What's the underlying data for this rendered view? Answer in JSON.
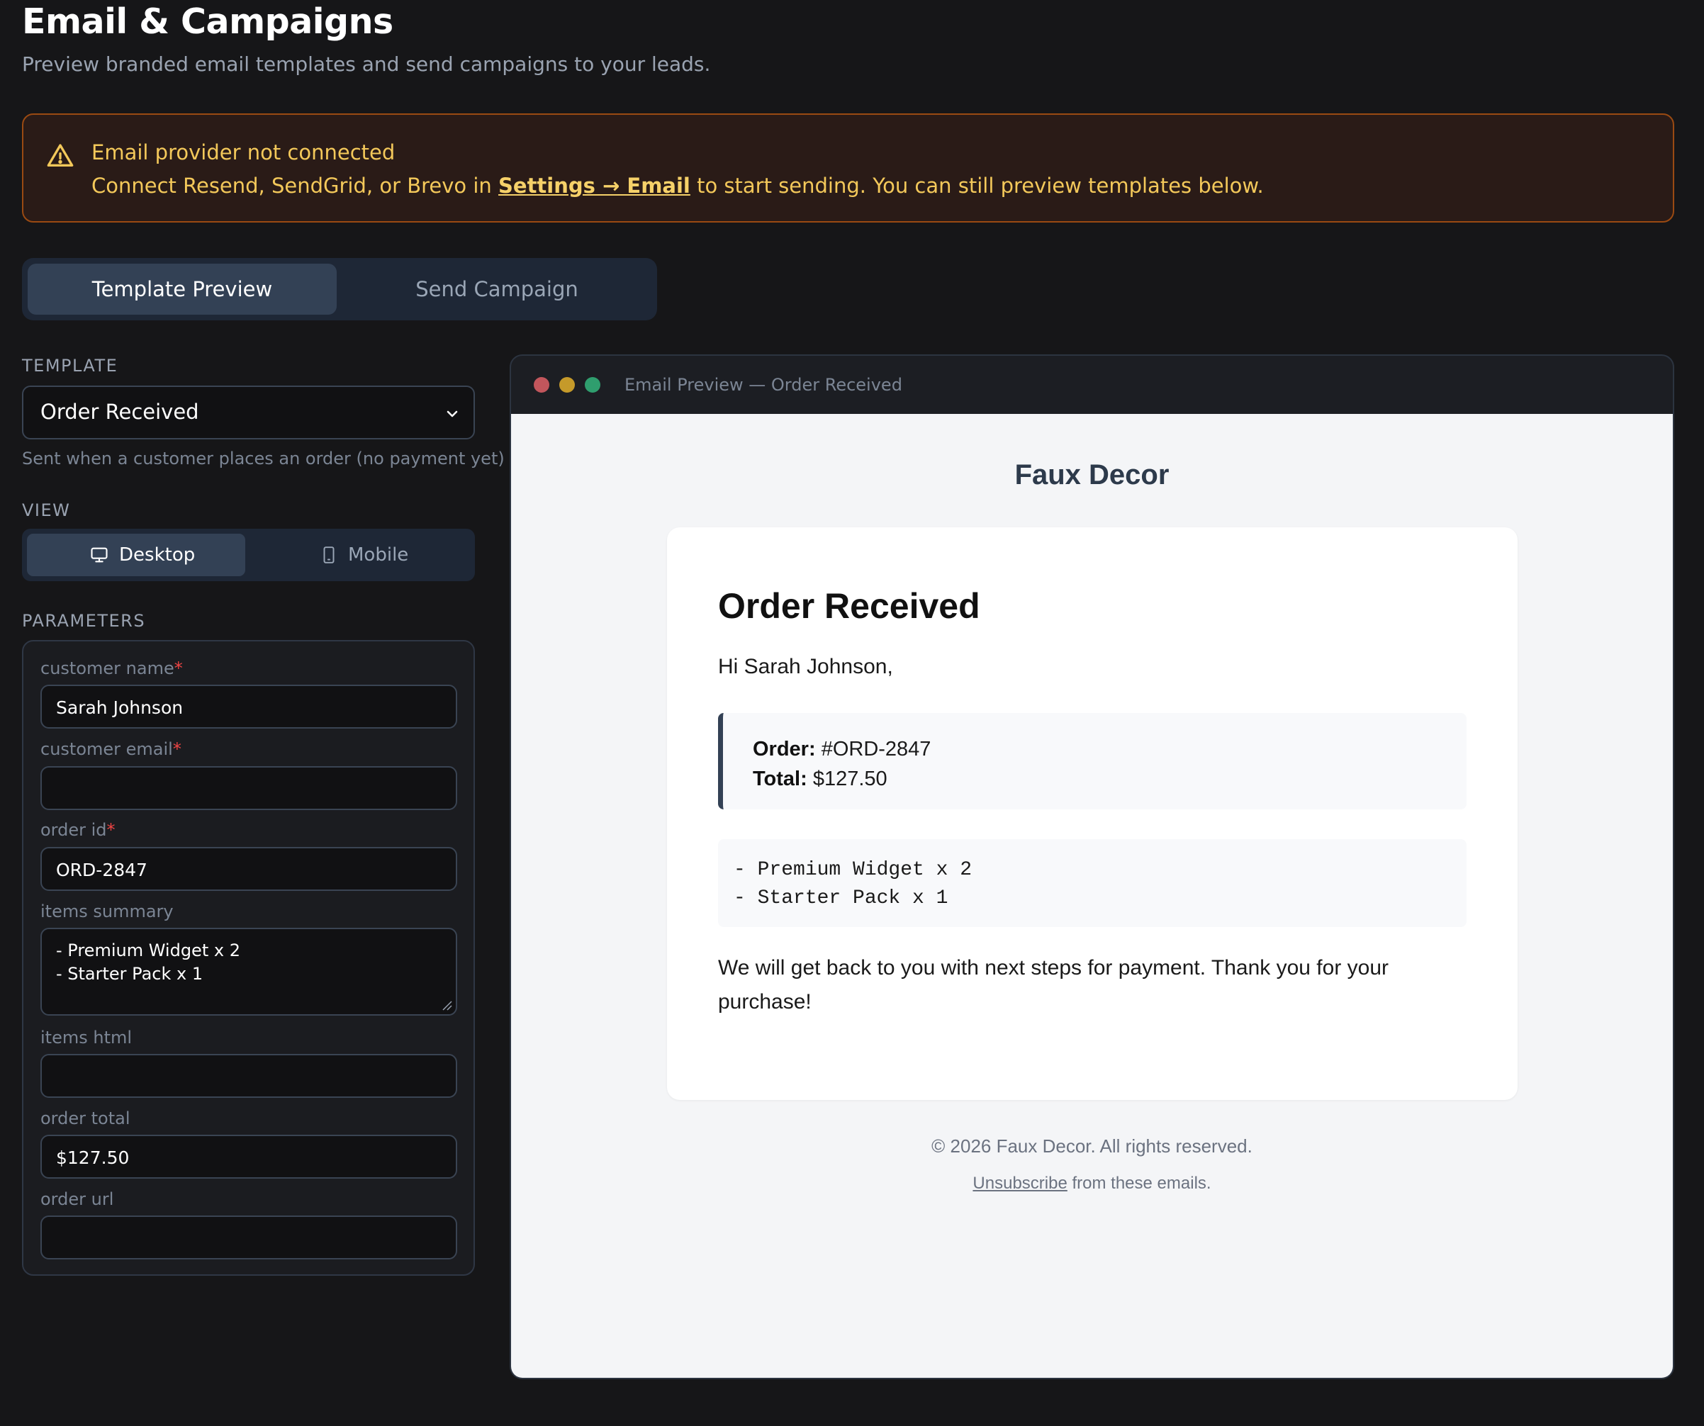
{
  "header": {
    "title": "Email & Campaigns",
    "subtitle": "Preview branded email templates and send campaigns to your leads."
  },
  "alert": {
    "icon": "warning-triangle-icon",
    "title": "Email provider not connected",
    "body_before": "Connect Resend, SendGrid, or Brevo in ",
    "link": "Settings → Email",
    "body_after": " to start sending. You can still preview templates below."
  },
  "tabs": [
    {
      "label": "Template Preview",
      "active": true
    },
    {
      "label": "Send Campaign",
      "active": false
    }
  ],
  "template": {
    "label": "TEMPLATE",
    "selected": "Order Received",
    "hint": "Sent when a customer places an order (no payment yet)"
  },
  "view": {
    "label": "VIEW",
    "options": [
      {
        "label": "Desktop",
        "icon": "monitor-icon",
        "active": true
      },
      {
        "label": "Mobile",
        "icon": "phone-icon",
        "active": false
      }
    ]
  },
  "parameters": {
    "label": "PARAMETERS",
    "fields": [
      {
        "label": "customer name",
        "required": true,
        "value": "Sarah Johnson"
      },
      {
        "label": "customer email",
        "required": true,
        "value": ""
      },
      {
        "label": "order id",
        "required": true,
        "value": "ORD-2847"
      },
      {
        "label": "items summary",
        "required": false,
        "value_lines": [
          "- Premium Widget x 2",
          "- Starter Pack x 1"
        ]
      },
      {
        "label": "items html",
        "required": false,
        "value": ""
      },
      {
        "label": "order total",
        "required": false,
        "value": "$127.50"
      },
      {
        "label": "order url",
        "required": false,
        "value": ""
      }
    ]
  },
  "preview": {
    "window_title": "Email Preview — Order Received",
    "brand": "Faux Decor",
    "heading": "Order Received",
    "greeting": "Hi Sarah Johnson,",
    "order_label": "Order:",
    "order_value": " #ORD-2847",
    "total_label": "Total:",
    "total_value": " $127.50",
    "items": [
      "- Premium Widget x 2",
      "- Starter Pack x 1"
    ],
    "closing": "We will get back to you with next steps for payment. Thank you for your purchase!",
    "footer_copyright": "© 2026 Faux Decor. All rights reserved.",
    "footer_unsubscribe": "Unsubscribe",
    "footer_after": " from these emails."
  },
  "colors": {
    "background": "#161618",
    "alert_text": "#f3c85a",
    "alert_border": "#9a4a12",
    "active_tab": "#334155",
    "required": "#ef4444",
    "dot_red": "#c2565c",
    "dot_yellow": "#c59a2a",
    "dot_green": "#2f9e6e"
  }
}
